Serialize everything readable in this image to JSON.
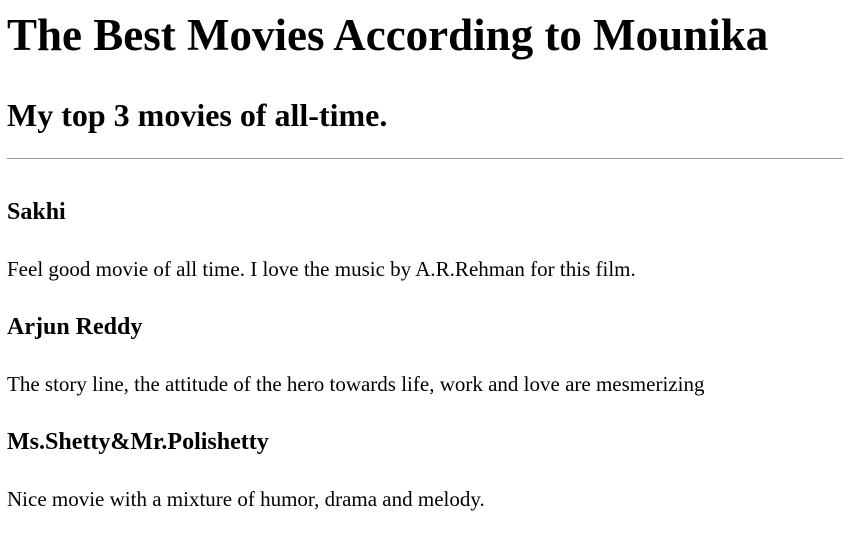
{
  "page": {
    "title": "The Best Movies According to Mounika",
    "subtitle": "My top 3 movies of all-time."
  },
  "movies": [
    {
      "title": "Sakhi",
      "description": "Feel good movie of all time. I love the music by A.R.Rehman for this film."
    },
    {
      "title": "Arjun Reddy",
      "description": "The story line, the attitude of the hero towards life, work and love are mesmerizing"
    },
    {
      "title": "Ms.Shetty&Mr.Polishetty",
      "description": "Nice movie with a mixture of humor, drama and melody."
    }
  ]
}
